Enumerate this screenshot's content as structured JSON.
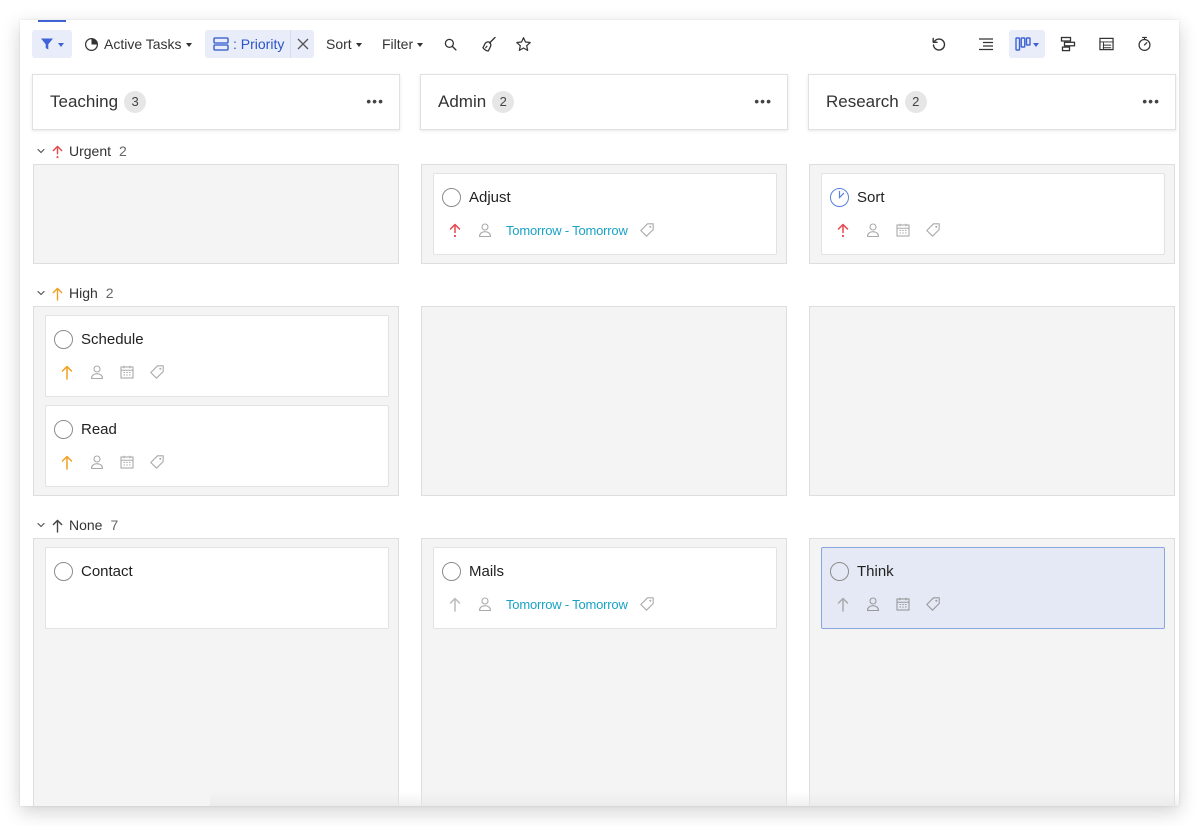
{
  "colors": {
    "accent": "#3f63d6",
    "urgent": "#e5484d",
    "high": "#f0a020",
    "none": "#555555",
    "date": "#19a2c5",
    "lane_bg": "#f4f4f4",
    "selected_card": "#e4e9f5"
  },
  "toolbar": {
    "filter_icon": "funnel-icon",
    "view_label": "Active Tasks",
    "group_by_label": ": Priority",
    "sort_label": "Sort",
    "filter_label": "Filter",
    "right_icons": [
      "undo-icon",
      "outline-icon",
      "board-view-icon",
      "gantt-icon",
      "table-icon",
      "timer-icon"
    ]
  },
  "columns": [
    {
      "title": "Teaching",
      "count": "3"
    },
    {
      "title": "Admin",
      "count": "2"
    },
    {
      "title": "Research",
      "count": "2"
    }
  ],
  "groups": [
    {
      "name": "Urgent",
      "count": "2",
      "arrow_color": "#e5484d"
    },
    {
      "name": "High",
      "count": "2",
      "arrow_color": "#f0a020"
    },
    {
      "name": "None",
      "count": "7",
      "arrow_color": "#555555"
    }
  ],
  "cards": {
    "admin_urgent": {
      "title": "Adjust",
      "dates": "Tomorrow - Tomorrow",
      "status": "open"
    },
    "research_urgent": {
      "title": "Sort",
      "status": "in-progress"
    },
    "teaching_high_1": {
      "title": "Schedule",
      "status": "open"
    },
    "teaching_high_2": {
      "title": "Read",
      "status": "open"
    },
    "teaching_none_1": {
      "title": "Contact",
      "status": "open"
    },
    "admin_none_1": {
      "title": "Mails",
      "dates": "Tomorrow - Tomorrow",
      "status": "open"
    },
    "research_none_1": {
      "title": "Think",
      "status": "open",
      "selected": true
    }
  }
}
